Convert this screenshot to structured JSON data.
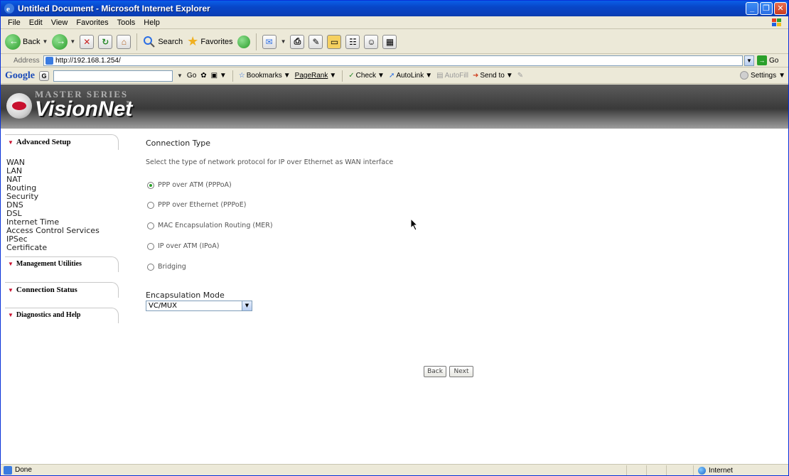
{
  "window": {
    "title": "Untitled Document - Microsoft Internet Explorer",
    "buttons": [
      "_",
      "❐",
      "✕"
    ]
  },
  "menu": [
    "File",
    "Edit",
    "View",
    "Favorites",
    "Tools",
    "Help"
  ],
  "toolbar": {
    "back_label": "Back",
    "search_label": "Search",
    "favorites_label": "Favorites"
  },
  "address": {
    "label": "Address",
    "url": "http://192.168.1.254/",
    "go_label": "Go"
  },
  "google_bar": {
    "logo": "Google",
    "go_label": "Go",
    "bookmarks_label": "Bookmarks",
    "pagerank_label": "PageRank",
    "check_label": "Check",
    "autolink_label": "AutoLink",
    "autofill_label": "AutoFill",
    "sendto_label": "Send to",
    "settings_label": "Settings"
  },
  "banner": {
    "series": "MASTER SERIES",
    "brand": "VisionNet",
    "tm": "™"
  },
  "sidebar": {
    "sections": [
      {
        "label": "Advanced Setup"
      },
      {
        "label": "Management Utilities"
      },
      {
        "label": "Connection Status"
      },
      {
        "label": "Diagnostics and Help"
      }
    ],
    "items": [
      "WAN",
      "LAN",
      "NAT",
      "Routing",
      "Security",
      "DNS",
      "DSL",
      "Internet Time",
      "Access Control Services",
      "IPSec",
      "Certificate"
    ]
  },
  "main": {
    "heading": "Connection Type",
    "description": "Select the type of network protocol for IP over Ethernet as WAN interface",
    "options": [
      {
        "label": "PPP over ATM (PPPoA)",
        "checked": true
      },
      {
        "label": "PPP over Ethernet (PPPoE)",
        "checked": false
      },
      {
        "label": "MAC Encapsulation Routing (MER)",
        "checked": false
      },
      {
        "label": "IP over ATM (IPoA)",
        "checked": false
      },
      {
        "label": "Bridging",
        "checked": false
      }
    ],
    "encapsulation_label": "Encapsulation Mode",
    "encapsulation_value": "VC/MUX",
    "back_button": "Back",
    "next_button": "Next"
  },
  "status": {
    "left": "Done",
    "zone": "Internet"
  }
}
